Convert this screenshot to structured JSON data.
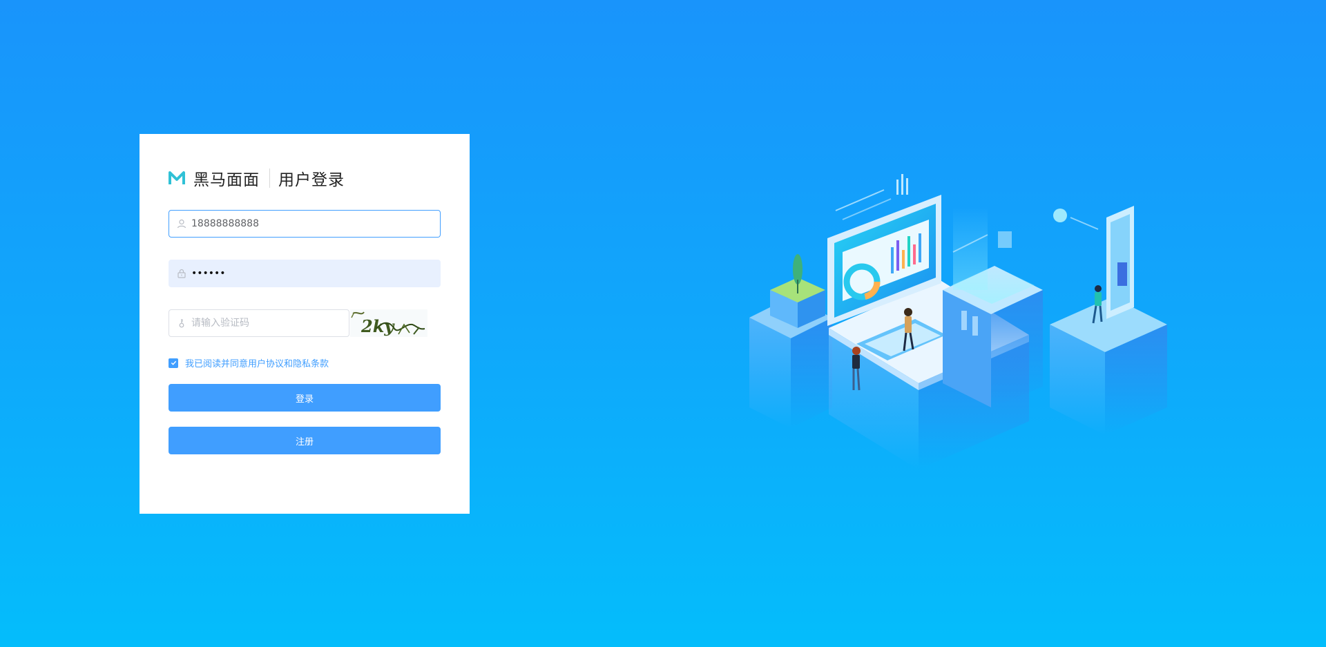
{
  "brand": {
    "logo_icon": "m-logo-icon",
    "name": "黑马面面",
    "accent": "#30c1d6"
  },
  "page": {
    "title": "用户登录",
    "background_top": "#1994fb",
    "background_bottom": "#04bdfb"
  },
  "form": {
    "username": {
      "value": "18888888888",
      "icon": "user-icon"
    },
    "password": {
      "value": "••••••",
      "icon": "lock-icon"
    },
    "captcha": {
      "value": "",
      "placeholder": "请输入验证码",
      "icon": "key-icon",
      "image_text": "2ky"
    },
    "agreement": {
      "checked": true,
      "label": "我已阅读并同意用户协议和隐私条款"
    },
    "login_label": "登录",
    "register_label": "注册",
    "primary_color": "#409eff"
  }
}
